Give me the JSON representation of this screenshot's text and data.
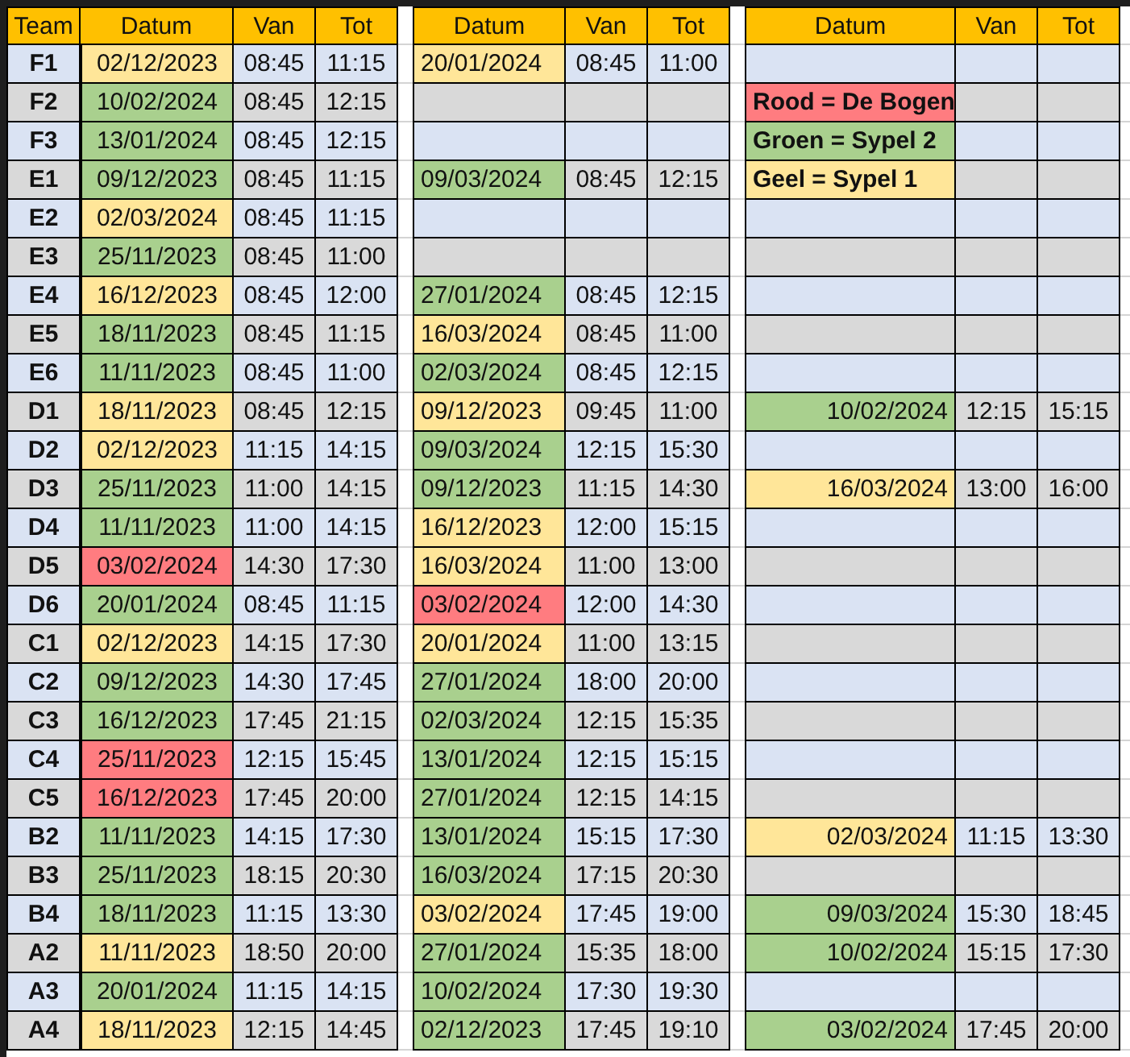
{
  "headers": [
    "Team",
    "Datum",
    "Van",
    "Tot",
    "Datum",
    "Van",
    "Tot",
    "Datum",
    "Van",
    "Tot"
  ],
  "rows": [
    {
      "team": "F1",
      "slots": [
        {
          "kind": "booking",
          "date": "02/12/2023",
          "color": "#ffe699",
          "from": "08:45",
          "to": "11:15"
        },
        {
          "kind": "booking",
          "date": "20/01/2024",
          "color": "#ffe699",
          "from": "08:45",
          "to": "11:00"
        },
        {
          "kind": "empty"
        }
      ]
    },
    {
      "team": "F2",
      "slots": [
        {
          "kind": "booking",
          "date": "10/02/2024",
          "color": "#a9d08e",
          "from": "08:45",
          "to": "12:15"
        },
        {
          "kind": "empty"
        },
        {
          "kind": "legend",
          "text": "Rood = De Bogen",
          "color": "#ff7c80"
        }
      ]
    },
    {
      "team": "F3",
      "slots": [
        {
          "kind": "booking",
          "date": "13/01/2024",
          "color": "#a9d08e",
          "from": "08:45",
          "to": "12:15"
        },
        {
          "kind": "empty"
        },
        {
          "kind": "legend",
          "text": "Groen = Sypel 2",
          "color": "#a9d08e"
        }
      ]
    },
    {
      "team": "E1",
      "slots": [
        {
          "kind": "booking",
          "date": "09/12/2023",
          "color": "#a9d08e",
          "from": "08:45",
          "to": "11:15"
        },
        {
          "kind": "booking",
          "date": "09/03/2024",
          "color": "#a9d08e",
          "from": "08:45",
          "to": "12:15"
        },
        {
          "kind": "legend",
          "text": "Geel = Sypel 1",
          "color": "#ffe699"
        }
      ]
    },
    {
      "team": "E2",
      "slots": [
        {
          "kind": "booking",
          "date": "02/03/2024",
          "color": "#ffe699",
          "from": "08:45",
          "to": "11:15"
        },
        {
          "kind": "empty"
        },
        {
          "kind": "empty"
        }
      ]
    },
    {
      "team": "E3",
      "slots": [
        {
          "kind": "booking",
          "date": "25/11/2023",
          "color": "#a9d08e",
          "from": "08:45",
          "to": "11:00"
        },
        {
          "kind": "empty"
        },
        {
          "kind": "empty"
        }
      ]
    },
    {
      "team": "E4",
      "slots": [
        {
          "kind": "booking",
          "date": "16/12/2023",
          "color": "#ffe699",
          "from": "08:45",
          "to": "12:00"
        },
        {
          "kind": "booking",
          "date": "27/01/2024",
          "color": "#a9d08e",
          "from": "08:45",
          "to": "12:15"
        },
        {
          "kind": "empty"
        }
      ]
    },
    {
      "team": "E5",
      "slots": [
        {
          "kind": "booking",
          "date": "18/11/2023",
          "color": "#a9d08e",
          "from": "08:45",
          "to": "11:15"
        },
        {
          "kind": "booking",
          "date": "16/03/2024",
          "color": "#ffe699",
          "from": "08:45",
          "to": "11:00"
        },
        {
          "kind": "empty"
        }
      ]
    },
    {
      "team": "E6",
      "slots": [
        {
          "kind": "booking",
          "date": "11/11/2023",
          "color": "#a9d08e",
          "from": "08:45",
          "to": "11:00"
        },
        {
          "kind": "booking",
          "date": "02/03/2024",
          "color": "#a9d08e",
          "from": "08:45",
          "to": "12:15"
        },
        {
          "kind": "empty"
        }
      ]
    },
    {
      "team": "D1",
      "slots": [
        {
          "kind": "booking",
          "date": "18/11/2023",
          "color": "#ffe699",
          "from": "08:45",
          "to": "12:15"
        },
        {
          "kind": "booking",
          "date": "09/12/2023",
          "color": "#ffe699",
          "from": "09:45",
          "to": "11:00"
        },
        {
          "kind": "booking",
          "date": "10/02/2024",
          "color": "#a9d08e",
          "from": "12:15",
          "to": "15:15"
        }
      ]
    },
    {
      "team": "D2",
      "slots": [
        {
          "kind": "booking",
          "date": "02/12/2023",
          "color": "#ffe699",
          "from": "11:15",
          "to": "14:15"
        },
        {
          "kind": "booking",
          "date": "09/03/2024",
          "color": "#a9d08e",
          "from": "12:15",
          "to": "15:30"
        },
        {
          "kind": "empty"
        }
      ]
    },
    {
      "team": "D3",
      "slots": [
        {
          "kind": "booking",
          "date": "25/11/2023",
          "color": "#a9d08e",
          "from": "11:00",
          "to": "14:15"
        },
        {
          "kind": "booking",
          "date": "09/12/2023",
          "color": "#a9d08e",
          "from": "11:15",
          "to": "14:30"
        },
        {
          "kind": "booking",
          "date": "16/03/2024",
          "color": "#ffe699",
          "from": "13:00",
          "to": "16:00"
        }
      ]
    },
    {
      "team": "D4",
      "slots": [
        {
          "kind": "booking",
          "date": "11/11/2023",
          "color": "#a9d08e",
          "from": "11:00",
          "to": "14:15"
        },
        {
          "kind": "booking",
          "date": "16/12/2023",
          "color": "#ffe699",
          "from": "12:00",
          "to": "15:15"
        },
        {
          "kind": "empty"
        }
      ]
    },
    {
      "team": "D5",
      "slots": [
        {
          "kind": "booking",
          "date": "03/02/2024",
          "color": "#ff7c80",
          "from": "14:30",
          "to": "17:30"
        },
        {
          "kind": "booking",
          "date": "16/03/2024",
          "color": "#ffe699",
          "from": "11:00",
          "to": "13:00"
        },
        {
          "kind": "empty"
        }
      ]
    },
    {
      "team": "D6",
      "slots": [
        {
          "kind": "booking",
          "date": "20/01/2024",
          "color": "#a9d08e",
          "from": "08:45",
          "to": "11:15"
        },
        {
          "kind": "booking",
          "date": "03/02/2024",
          "color": "#ff7c80",
          "from": "12:00",
          "to": "14:30"
        },
        {
          "kind": "empty"
        }
      ]
    },
    {
      "team": "C1",
      "slots": [
        {
          "kind": "booking",
          "date": "02/12/2023",
          "color": "#ffe699",
          "from": "14:15",
          "to": "17:30"
        },
        {
          "kind": "booking",
          "date": "20/01/2024",
          "color": "#ffe699",
          "from": "11:00",
          "to": "13:15"
        },
        {
          "kind": "empty"
        }
      ]
    },
    {
      "team": "C2",
      "slots": [
        {
          "kind": "booking",
          "date": "09/12/2023",
          "color": "#a9d08e",
          "from": "14:30",
          "to": "17:45"
        },
        {
          "kind": "booking",
          "date": "27/01/2024",
          "color": "#a9d08e",
          "from": "18:00",
          "to": "20:00"
        },
        {
          "kind": "empty"
        }
      ]
    },
    {
      "team": "C3",
      "slots": [
        {
          "kind": "booking",
          "date": "16/12/2023",
          "color": "#a9d08e",
          "from": "17:45",
          "to": "21:15"
        },
        {
          "kind": "booking",
          "date": "02/03/2024",
          "color": "#a9d08e",
          "from": "12:15",
          "to": "15:35"
        },
        {
          "kind": "empty"
        }
      ]
    },
    {
      "team": "C4",
      "slots": [
        {
          "kind": "booking",
          "date": "25/11/2023",
          "color": "#ff7c80",
          "from": "12:15",
          "to": "15:45"
        },
        {
          "kind": "booking",
          "date": "13/01/2024",
          "color": "#a9d08e",
          "from": "12:15",
          "to": "15:15"
        },
        {
          "kind": "empty"
        }
      ]
    },
    {
      "team": "C5",
      "slots": [
        {
          "kind": "booking",
          "date": "16/12/2023",
          "color": "#ff7c80",
          "from": "17:45",
          "to": "20:00"
        },
        {
          "kind": "booking",
          "date": "27/01/2024",
          "color": "#a9d08e",
          "from": "12:15",
          "to": "14:15"
        },
        {
          "kind": "empty"
        }
      ]
    },
    {
      "team": "B2",
      "slots": [
        {
          "kind": "booking",
          "date": "11/11/2023",
          "color": "#a9d08e",
          "from": "14:15",
          "to": "17:30"
        },
        {
          "kind": "booking",
          "date": "13/01/2024",
          "color": "#a9d08e",
          "from": "15:15",
          "to": "17:30"
        },
        {
          "kind": "booking",
          "date": "02/03/2024",
          "color": "#ffe699",
          "from": "11:15",
          "to": "13:30"
        }
      ]
    },
    {
      "team": "B3",
      "slots": [
        {
          "kind": "booking",
          "date": "25/11/2023",
          "color": "#a9d08e",
          "from": "18:15",
          "to": "20:30"
        },
        {
          "kind": "booking",
          "date": "16/03/2024",
          "color": "#a9d08e",
          "from": "17:15",
          "to": "20:30"
        },
        {
          "kind": "empty"
        }
      ]
    },
    {
      "team": "B4",
      "slots": [
        {
          "kind": "booking",
          "date": "18/11/2023",
          "color": "#a9d08e",
          "from": "11:15",
          "to": "13:30"
        },
        {
          "kind": "booking",
          "date": "03/02/2024",
          "color": "#ffe699",
          "from": "17:45",
          "to": "19:00"
        },
        {
          "kind": "booking",
          "date": "09/03/2024",
          "color": "#a9d08e",
          "from": "15:30",
          "to": "18:45"
        }
      ]
    },
    {
      "team": "A2",
      "slots": [
        {
          "kind": "booking",
          "date": "11/11/2023",
          "color": "#ffe699",
          "from": "18:50",
          "to": "20:00"
        },
        {
          "kind": "booking",
          "date": "27/01/2024",
          "color": "#a9d08e",
          "from": "15:35",
          "to": "18:00"
        },
        {
          "kind": "booking",
          "date": "10/02/2024",
          "color": "#a9d08e",
          "from": "15:15",
          "to": "17:30"
        }
      ]
    },
    {
      "team": "A3",
      "slots": [
        {
          "kind": "booking",
          "date": "20/01/2024",
          "color": "#a9d08e",
          "from": "11:15",
          "to": "14:15"
        },
        {
          "kind": "booking",
          "date": "10/02/2024",
          "color": "#a9d08e",
          "from": "17:30",
          "to": "19:30"
        },
        {
          "kind": "empty"
        }
      ]
    },
    {
      "team": "A4",
      "slots": [
        {
          "kind": "booking",
          "date": "18/11/2023",
          "color": "#ffe699",
          "from": "12:15",
          "to": "14:45"
        },
        {
          "kind": "booking",
          "date": "02/12/2023",
          "color": "#a9d08e",
          "from": "17:45",
          "to": "19:10"
        },
        {
          "kind": "booking",
          "date": "03/02/2024",
          "color": "#a9d08e",
          "from": "17:45",
          "to": "20:00"
        }
      ]
    }
  ]
}
